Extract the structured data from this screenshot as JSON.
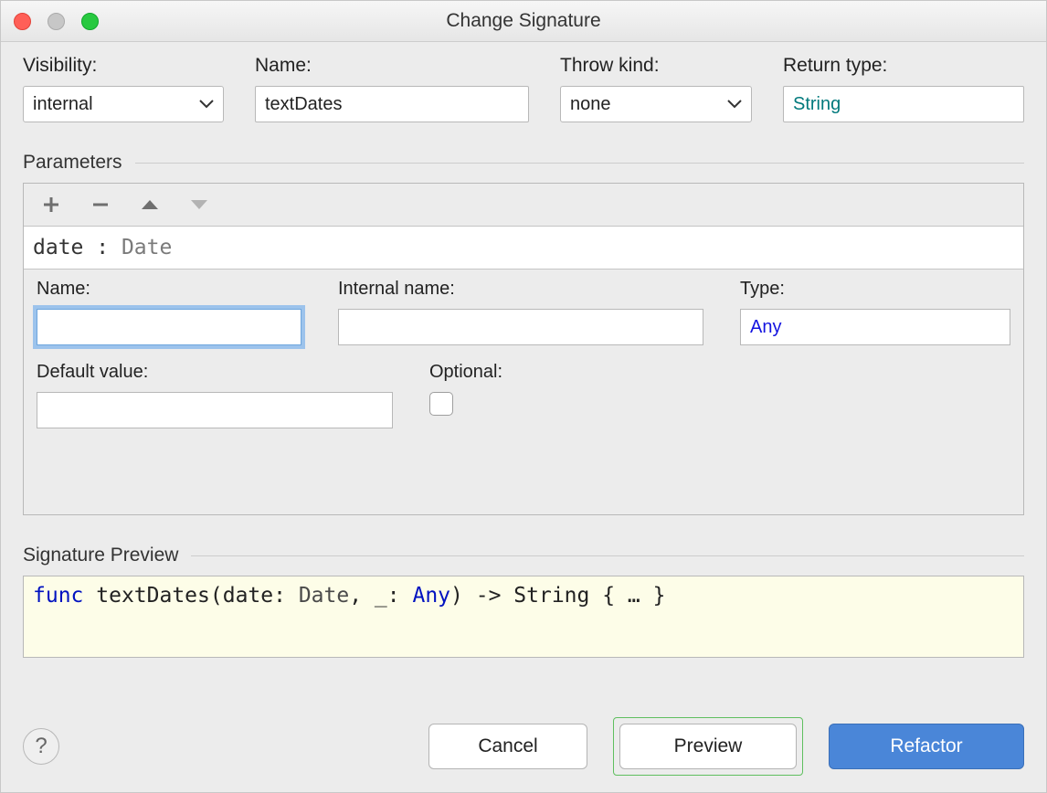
{
  "window": {
    "title": "Change Signature"
  },
  "fields": {
    "visibility": {
      "label": "Visibility:",
      "value": "internal"
    },
    "name": {
      "label": "Name:",
      "value": "textDates"
    },
    "throw_kind": {
      "label": "Throw kind:",
      "value": "none"
    },
    "return_type": {
      "label": "Return type:",
      "value": "String"
    }
  },
  "parameters": {
    "header": "Parameters",
    "list": {
      "raw": "date : Date",
      "name": "date",
      "type": "Date"
    },
    "detail": {
      "name": {
        "label": "Name:",
        "value": ""
      },
      "internal_name": {
        "label": "Internal name:",
        "value": ""
      },
      "type": {
        "label": "Type:",
        "value": "Any"
      },
      "default_value": {
        "label": "Default value:",
        "value": ""
      },
      "optional": {
        "label": "Optional:",
        "checked": false
      }
    }
  },
  "signature_preview": {
    "header": "Signature Preview",
    "tokens": {
      "func": "func",
      "fname": "textDates",
      "p1name": "date",
      "p1type": "Date",
      "p2name": "_",
      "p2type": "Any",
      "ret": "String",
      "body": "{ … }"
    }
  },
  "buttons": {
    "help": "?",
    "cancel": "Cancel",
    "preview": "Preview",
    "refactor": "Refactor"
  },
  "icons": {
    "plus": "plus-icon",
    "minus": "minus-icon",
    "up": "triangle-up-icon",
    "down": "triangle-down-icon",
    "chevron": "chevron-down-icon"
  }
}
